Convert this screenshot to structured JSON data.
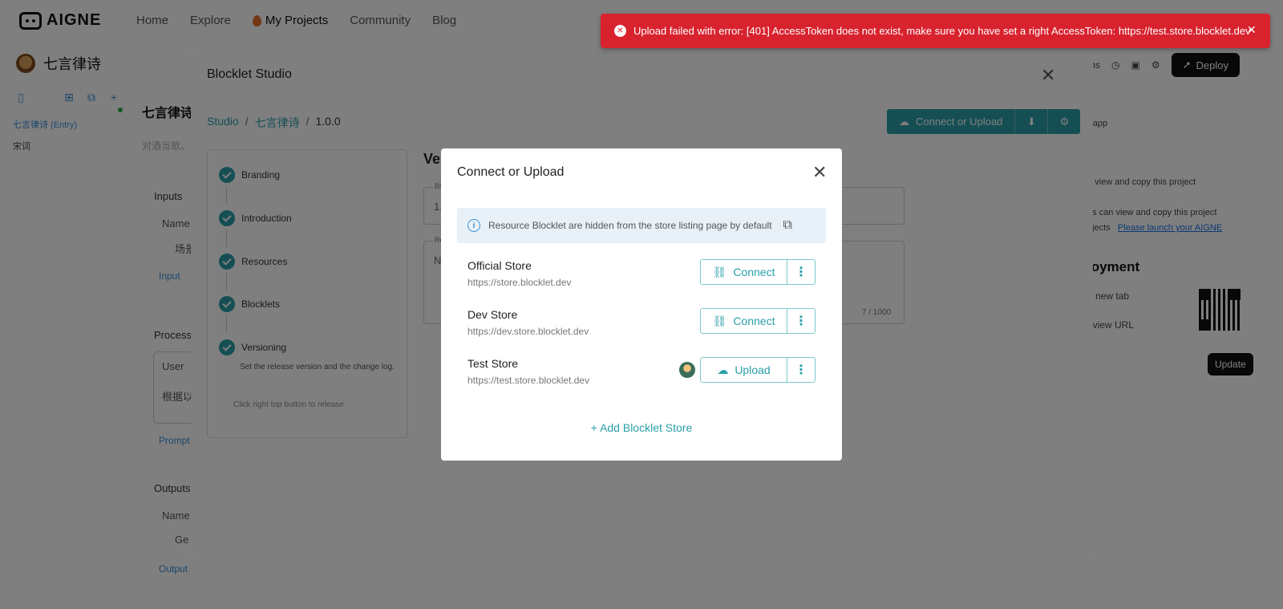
{
  "nav": {
    "brand": "AIGNE",
    "links": [
      "Home",
      "Explore",
      "My Projects",
      "Community",
      "Blog"
    ]
  },
  "project": {
    "name": "七言律诗",
    "entry": "七言律诗 (Entry)",
    "second": "宋词",
    "title": "七言律诗",
    "description": "对酒当歌。"
  },
  "bg": {
    "inputs": "Inputs",
    "name_col": "Name",
    "input_row": "场景",
    "add_input": "Input",
    "process": "Process",
    "user": "User",
    "prompt_text": "根据以",
    "add_prompt": "Prompt",
    "outputs": "Outputs",
    "output_name": "Name",
    "output_row": "Ge",
    "add_output": "Output"
  },
  "right_panel": {
    "tokens": "okens",
    "deploy": "Deploy",
    "line1": "r app",
    "line2": "n view and copy this project",
    "line3": "ns can view and copy this project",
    "line4_prefix": "ojects",
    "launch_link": "Please launch your AIGNE",
    "deployment": "loyment",
    "new_tab": "n new tab",
    "preview_url": "eview URL",
    "update": "Update"
  },
  "studio": {
    "title": "Blocklet Studio",
    "breadcrumb": [
      "Studio",
      "七言律诗",
      "1.0.0"
    ],
    "connect_upload": "Connect or Upload",
    "steps": [
      "Branding",
      "Introduction",
      "Resources",
      "Blocklets",
      "Versioning"
    ],
    "versioning_desc": "Set the release version and the change log.",
    "hint": "Click right top button to release",
    "version_heading": "Ve",
    "input_label": "Bl",
    "input_value": "1.",
    "notes_label": "Re",
    "notes_value": "N",
    "counter": "7 / 1000"
  },
  "dialog": {
    "title": "Connect or Upload",
    "info": "Resource Blocklet are hidden from the store listing page by default",
    "stores": [
      {
        "name": "Official Store",
        "url": "https://store.blocklet.dev",
        "action": "Connect"
      },
      {
        "name": "Dev Store",
        "url": "https://dev.store.blocklet.dev",
        "action": "Connect"
      },
      {
        "name": "Test Store",
        "url": "https://test.store.blocklet.dev",
        "action": "Upload"
      }
    ],
    "add_store": "Add Blocklet Store"
  },
  "toast": {
    "message": "Upload failed with error: [401] AccessToken does not exist, make sure you have set a right AccessToken: https://test.store.blocklet.dev"
  },
  "colors": {
    "accent": "#2a9fa8",
    "error": "#d8232f",
    "info_bg": "#e8f1f8"
  }
}
